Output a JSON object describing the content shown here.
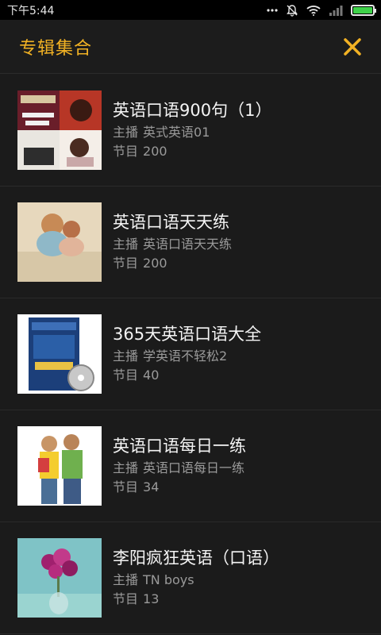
{
  "status": {
    "time": "下午5:44",
    "battery_level": 1.0
  },
  "header": {
    "title": "专辑集合"
  },
  "albums": [
    {
      "title": "英语口语900句（1）",
      "host_label": "主播",
      "host": "英式英语01",
      "count_label": "节目",
      "count": "200"
    },
    {
      "title": "英语口语天天练",
      "host_label": "主播",
      "host": "英语口语天天练",
      "count_label": "节目",
      "count": "200"
    },
    {
      "title": "365天英语口语大全",
      "host_label": "主播",
      "host": "学英语不轻松2",
      "count_label": "节目",
      "count": "40"
    },
    {
      "title": "英语口语每日一练",
      "host_label": "主播",
      "host": "英语口语每日一练",
      "count_label": "节目",
      "count": "34"
    },
    {
      "title": "李阳疯狂英语（口语）",
      "host_label": "主播",
      "host": "TN  boys",
      "count_label": "节目",
      "count": "13"
    }
  ],
  "colors": {
    "accent": "#f2b224",
    "background": "#1b1b1b",
    "battery": "#3fd24a"
  }
}
